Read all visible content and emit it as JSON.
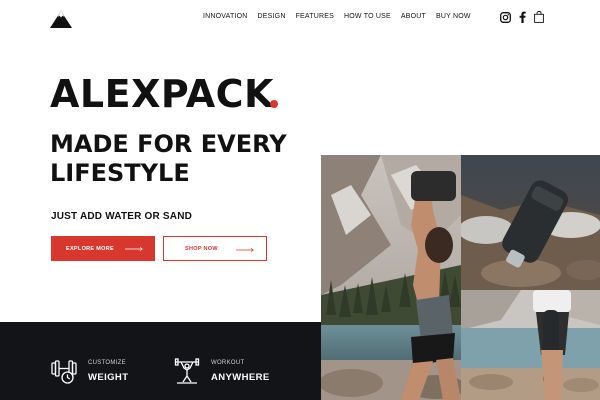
{
  "header": {
    "logo_icon": "mountain-logo-icon",
    "nav": [
      "INNOVATION",
      "DESIGN",
      "FEATURES",
      "HOW TO USE",
      "ABOUT",
      "BUY NOW"
    ],
    "social_icons": [
      "instagram-icon",
      "facebook-icon",
      "shopping-bag-icon"
    ]
  },
  "hero": {
    "brand": "ALEXPACK",
    "headline": "MADE FOR EVERY LIFESTYLE",
    "tagline": "JUST ADD WATER OR SAND",
    "buttons": {
      "explore": "EXPLORE MORE",
      "shop": "SHOP NOW"
    }
  },
  "features": [
    {
      "icon": "dumbbell-icon",
      "small": "CUSTOMIZE",
      "big": "WEIGHT"
    },
    {
      "icon": "weightlifter-icon",
      "small": "WORKOUT",
      "big": "ANYWHERE"
    }
  ],
  "photos": [
    {
      "name": "photo-woman-lifting-bag"
    },
    {
      "name": "photo-bag-on-rocks"
    },
    {
      "name": "photo-woman-holding-bag"
    }
  ],
  "colors": {
    "accent": "#d7372c",
    "dark": "#121417",
    "text": "#141414",
    "background": "#ffffff"
  }
}
